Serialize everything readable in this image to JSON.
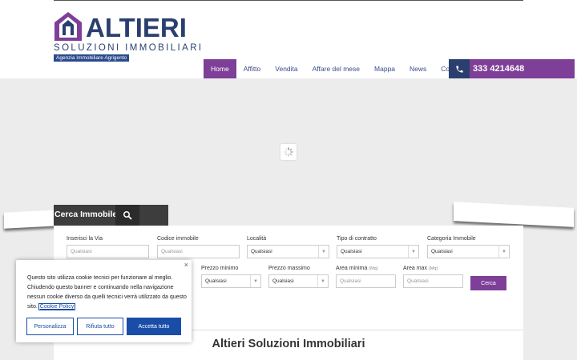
{
  "logo": {
    "title": "ALTIERI",
    "subtitle": "SOLUZIONI IMMOBILIARI",
    "tagline": "Agenzia Immobiliare Agrigento"
  },
  "nav": {
    "items": [
      {
        "label": "Home"
      },
      {
        "label": "Affitto"
      },
      {
        "label": "Vendita"
      },
      {
        "label": "Affare del mese"
      },
      {
        "label": "Mappa"
      },
      {
        "label": "News"
      },
      {
        "label": "Contatti"
      }
    ],
    "phone": "333 4214648"
  },
  "search": {
    "tab_label": "Cerca Immobile",
    "fields": {
      "via": {
        "label": "Inserisci la Via",
        "placeholder": "Qualsiasi"
      },
      "codice": {
        "label": "Codice immobile",
        "placeholder": "Qualsiasi"
      },
      "localita": {
        "label": "Località",
        "value": "Qualsiasi"
      },
      "contratto": {
        "label": "Tipo di contratto",
        "value": "Qualsiasi"
      },
      "categoria": {
        "label": "Categoria Immobile",
        "value": "Qualsiasi"
      },
      "prezzo_min": {
        "label": "Prezzo minimo",
        "value": "Qualsiasi"
      },
      "prezzo_max": {
        "label": "Prezzo massimo",
        "value": "Qualsiasi"
      },
      "area_min": {
        "label": "Area minima",
        "unit": "(Mq)",
        "placeholder": "Qualsiasi"
      },
      "area_max": {
        "label": "Area max",
        "unit": "(Mq)",
        "placeholder": "Qualsiasi"
      }
    },
    "submit": "Cerca"
  },
  "section": {
    "title": "Altieri Soluzioni Immobiliari"
  },
  "cookie": {
    "text": "Questo sito utilizza cookie tecnici per funzionare al meglio. Chiudendo questo banner e continuando nella navigazione nessun cookie diverso da quelli tecnici verrà utilizzato da questo sito.",
    "link": "Cookie Policy",
    "close": "×",
    "buttons": {
      "customize": "Personalizza",
      "reject": "Rifiuta tutto",
      "accept": "Accetta tutto"
    }
  },
  "colors": {
    "brand_purple": "#7e3f98",
    "brand_navy": "#2a3f6f",
    "cookie_blue": "#1a4da8"
  }
}
